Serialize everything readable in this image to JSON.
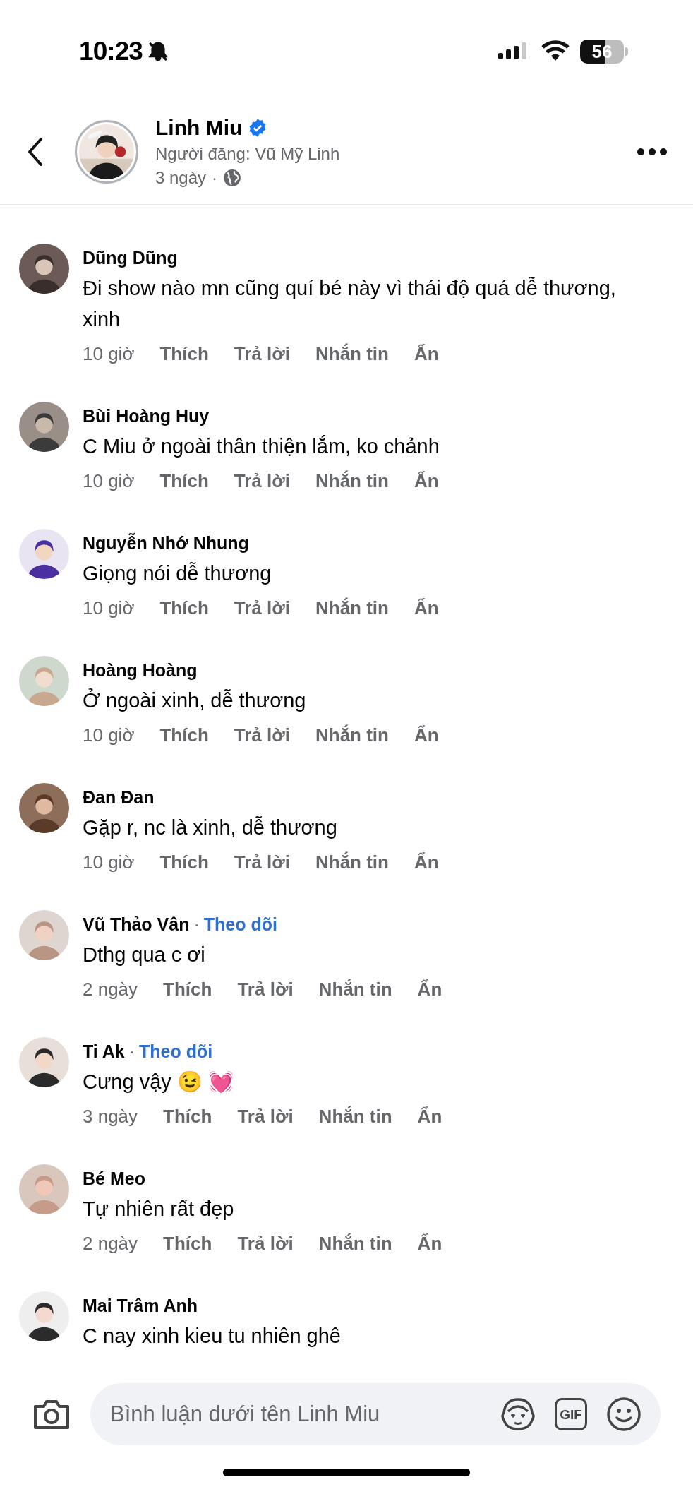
{
  "status_bar": {
    "time": "10:23",
    "battery": "56"
  },
  "header": {
    "title": "Linh Miu",
    "verified": true,
    "subtitle": "Người đăng: Vũ Mỹ Linh",
    "time": "3 ngày",
    "separator": "·"
  },
  "comments": [
    {
      "name": "Dũng Dũng",
      "text": "Đi show nào mn cũng quí bé này vì thái độ quá dễ thương, xinh",
      "time": "10 giờ",
      "actions": [
        "Thích",
        "Trả lời",
        "Nhắn tin",
        "Ẩn"
      ]
    },
    {
      "name": "Bùi Hoàng Huy",
      "text": "C Miu ở ngoài thân thiện lắm, ko chảnh",
      "time": "10 giờ",
      "actions": [
        "Thích",
        "Trả lời",
        "Nhắn tin",
        "Ẩn"
      ]
    },
    {
      "name": "Nguyễn Nhớ Nhung",
      "text": "Giọng nói dễ thương",
      "time": "10 giờ",
      "actions": [
        "Thích",
        "Trả lời",
        "Nhắn tin",
        "Ẩn"
      ]
    },
    {
      "name": "Hoàng Hoàng",
      "text": "Ở ngoài xinh, dễ thương",
      "time": "10 giờ",
      "actions": [
        "Thích",
        "Trả lời",
        "Nhắn tin",
        "Ẩn"
      ]
    },
    {
      "name": "Đan Đan",
      "text": "Gặp r, nc là xinh, dễ thương",
      "time": "10 giờ",
      "actions": [
        "Thích",
        "Trả lời",
        "Nhắn tin",
        "Ẩn"
      ]
    },
    {
      "name": "Vũ Thảo Vân",
      "separator": "·",
      "follow": "Theo dõi",
      "text": "Dthg qua c ơi",
      "time": "2 ngày",
      "actions": [
        "Thích",
        "Trả lời",
        "Nhắn tin",
        "Ẩn"
      ]
    },
    {
      "name": "Ti Ak",
      "separator": "·",
      "follow": "Theo dõi",
      "text": "Cưng vậy 😉 💓",
      "time": "3 ngày",
      "actions": [
        "Thích",
        "Trả lời",
        "Nhắn tin",
        "Ẩn"
      ]
    },
    {
      "name": "Bé Meo",
      "text": "Tự nhiên rất đẹp",
      "time": "2 ngày",
      "actions": [
        "Thích",
        "Trả lời",
        "Nhắn tin",
        "Ẩn"
      ]
    },
    {
      "name": "Mai Trâm Anh",
      "text": "C nay xinh kieu tu nhiên ghê"
    }
  ],
  "composer": {
    "placeholder": "Bình luận dưới tên Linh Miu",
    "gif": "GIF"
  }
}
